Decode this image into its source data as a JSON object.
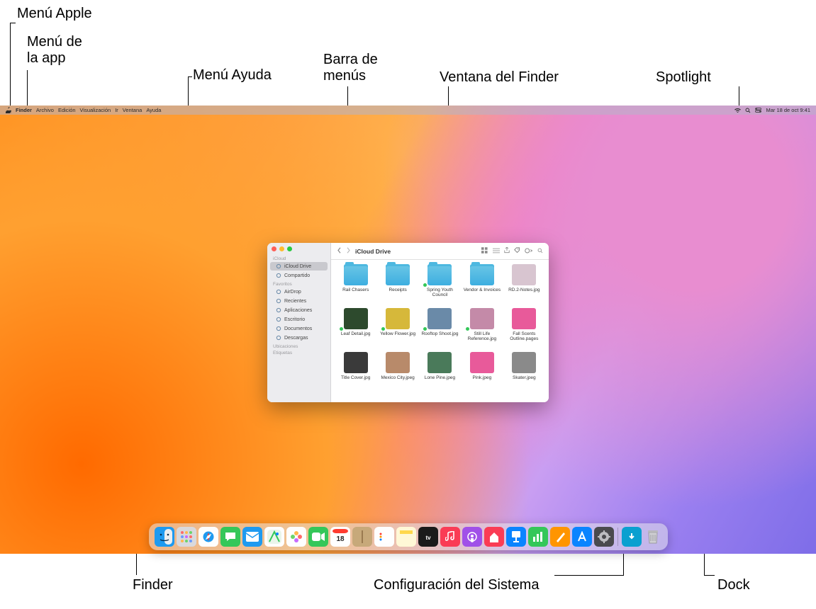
{
  "callouts": {
    "apple_menu": "Menú Apple",
    "app_menu": "Menú de\nla app",
    "help_menu": "Menú Ayuda",
    "menu_bar": "Barra de\nmenús",
    "finder_window": "Ventana del Finder",
    "spotlight": "Spotlight",
    "finder": "Finder",
    "system_settings": "Configuración del Sistema",
    "dock": "Dock"
  },
  "menubar": {
    "app": "Finder",
    "items": [
      "Archivo",
      "Edición",
      "Visualización",
      "Ir",
      "Ventana",
      "Ayuda"
    ],
    "datetime": "Mar 18 de oct  9:41"
  },
  "finder": {
    "title": "iCloud Drive",
    "sidebar": {
      "sections": [
        {
          "header": "iCloud",
          "items": [
            {
              "label": "iCloud Drive",
              "icon": "cloud",
              "selected": true
            },
            {
              "label": "Compartido",
              "icon": "folder-shared"
            }
          ]
        },
        {
          "header": "Favoritos",
          "items": [
            {
              "label": "AirDrop",
              "icon": "airdrop"
            },
            {
              "label": "Recientes",
              "icon": "clock"
            },
            {
              "label": "Aplicaciones",
              "icon": "apps"
            },
            {
              "label": "Escritorio",
              "icon": "desktop"
            },
            {
              "label": "Documentos",
              "icon": "doc"
            },
            {
              "label": "Descargas",
              "icon": "download"
            }
          ]
        },
        {
          "header": "Ubicaciones",
          "items": []
        },
        {
          "header": "Etiquetas",
          "items": []
        }
      ]
    },
    "files": [
      {
        "name": "Rail Chasers",
        "type": "folder",
        "tag": false
      },
      {
        "name": "Receipts",
        "type": "folder",
        "tag": false
      },
      {
        "name": "Spring Youth Council",
        "type": "folder",
        "tag": true
      },
      {
        "name": "Vendor & Invoices",
        "type": "folder",
        "tag": false
      },
      {
        "name": "RD.2-Notes.jpg",
        "type": "img",
        "tag": false,
        "bg": "#d8c5d0"
      },
      {
        "name": "Leaf Detail.jpg",
        "type": "img",
        "tag": true,
        "bg": "#2d4a2d"
      },
      {
        "name": "Yellow Flower.jpg",
        "type": "img",
        "tag": true,
        "bg": "#d6b83a"
      },
      {
        "name": "Rooftop Shoot.jpg",
        "type": "img",
        "tag": true,
        "bg": "#6a8aa8"
      },
      {
        "name": "Still Life Reference.jpg",
        "type": "img",
        "tag": true,
        "bg": "#c48aa8"
      },
      {
        "name": "Fall Scents Outline.pages",
        "type": "img",
        "tag": false,
        "bg": "#e85a9a"
      },
      {
        "name": "Title Cover.jpg",
        "type": "img",
        "tag": false,
        "bg": "#3a3a3a"
      },
      {
        "name": "Mexico City.jpeg",
        "type": "img",
        "tag": false,
        "bg": "#b88a6a"
      },
      {
        "name": "Lone Pine.jpeg",
        "type": "img",
        "tag": false,
        "bg": "#4a7a5a"
      },
      {
        "name": "Pink.jpeg",
        "type": "img",
        "tag": false,
        "bg": "#e85a9a"
      },
      {
        "name": "Skater.jpeg",
        "type": "img",
        "tag": false,
        "bg": "#8a8a8a"
      }
    ]
  },
  "dock": {
    "items": [
      {
        "name": "finder",
        "bg": "#1e9af0",
        "glyph": "finder"
      },
      {
        "name": "launchpad",
        "bg": "#d9d9dd",
        "glyph": "grid"
      },
      {
        "name": "safari",
        "bg": "#fefefe",
        "glyph": "compass"
      },
      {
        "name": "messages",
        "bg": "#34c759",
        "glyph": "bubble"
      },
      {
        "name": "mail",
        "bg": "#1e9af0",
        "glyph": "envelope"
      },
      {
        "name": "maps",
        "bg": "#fefefe",
        "glyph": "map"
      },
      {
        "name": "photos",
        "bg": "#fefefe",
        "glyph": "flower"
      },
      {
        "name": "facetime",
        "bg": "#34c759",
        "glyph": "video"
      },
      {
        "name": "calendar",
        "bg": "#fefefe",
        "glyph": "cal",
        "text": "18"
      },
      {
        "name": "contacts",
        "bg": "#c7a97a",
        "glyph": "book"
      },
      {
        "name": "reminders",
        "bg": "#fefefe",
        "glyph": "list"
      },
      {
        "name": "notes",
        "bg": "#fff8d6",
        "glyph": "note"
      },
      {
        "name": "tv",
        "bg": "#1a1a1a",
        "glyph": "tv"
      },
      {
        "name": "music",
        "bg": "#fa3c55",
        "glyph": "music"
      },
      {
        "name": "podcasts",
        "bg": "#a050e8",
        "glyph": "podcast"
      },
      {
        "name": "news",
        "bg": "#fa3c55",
        "glyph": "news"
      },
      {
        "name": "keynote",
        "bg": "#0a84ff",
        "glyph": "keynote"
      },
      {
        "name": "numbers",
        "bg": "#34c759",
        "glyph": "bars"
      },
      {
        "name": "pages",
        "bg": "#ff9500",
        "glyph": "pen"
      },
      {
        "name": "appstore",
        "bg": "#0a84ff",
        "glyph": "A"
      },
      {
        "name": "system-settings",
        "bg": "#4a4a4e",
        "glyph": "gear"
      }
    ],
    "right": [
      {
        "name": "downloads",
        "bg": "#0aa0d0",
        "glyph": "down"
      },
      {
        "name": "trash",
        "bg": "transparent",
        "glyph": "trash"
      }
    ]
  }
}
